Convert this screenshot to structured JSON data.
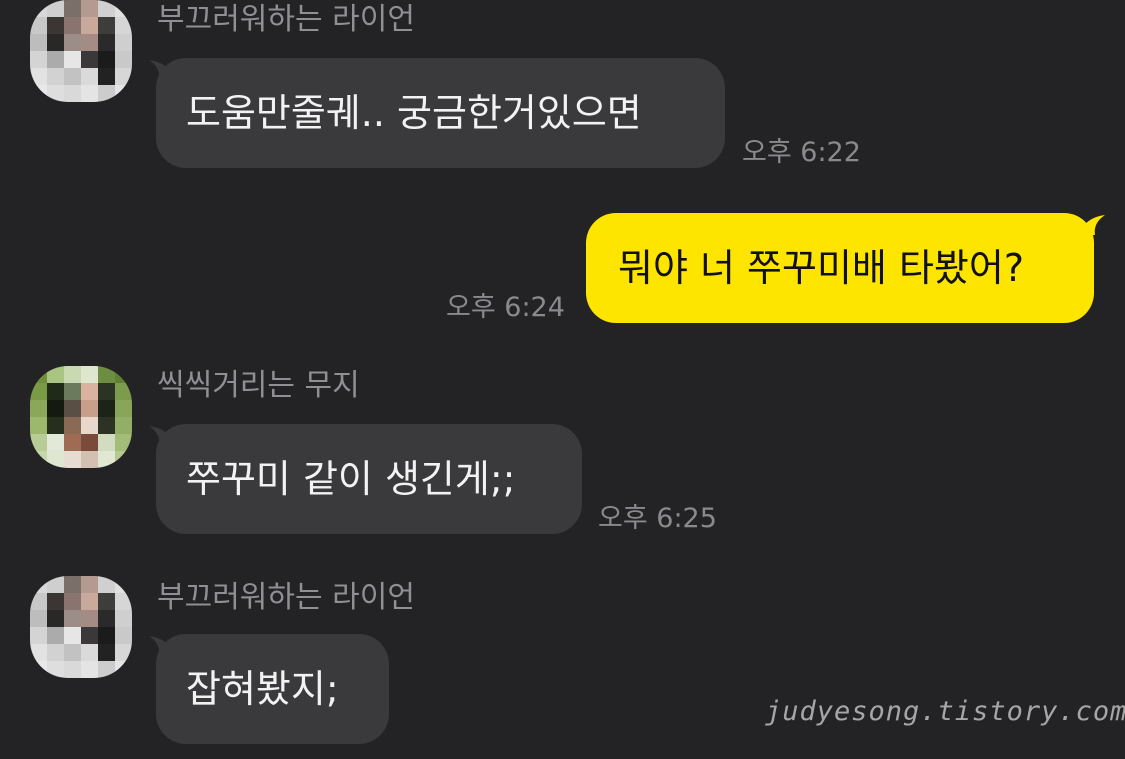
{
  "messages": [
    {
      "sender": "부끄러워하는 라이언",
      "text": "도움만줄궤.. 궁금한거있으면",
      "time": "오후 6:22"
    },
    {
      "text": "뭐야 너 쭈꾸미배 타봤어?",
      "time": "오후 6:24"
    },
    {
      "sender": "씩씩거리는 무지",
      "text": "쭈꾸미 같이 생긴게;;",
      "time": "오후 6:25"
    },
    {
      "sender": "부끄러워하는 라이언",
      "text": "잡혀봤지;"
    }
  ],
  "watermark": "judyesong.tistory.com",
  "colors": {
    "background": "#232325",
    "incoming_bubble": "#3a3a3c",
    "outgoing_bubble": "#fee500"
  }
}
